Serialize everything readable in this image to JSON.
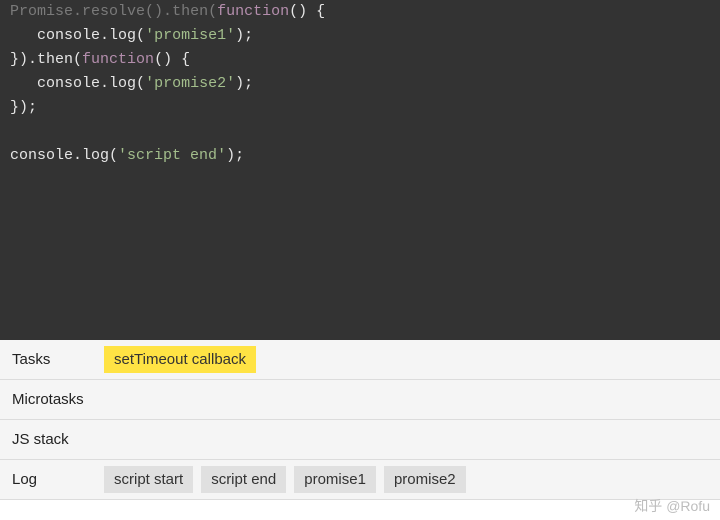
{
  "code": {
    "line1_a": "Promise",
    "line1_b": ".",
    "line1_c": "resolve",
    "line1_d": "().",
    "line1_e": "then",
    "line1_f": "(",
    "line1_g": "function",
    "line1_h": "() {",
    "line2_a": "   console.",
    "line2_b": "log",
    "line2_c": "(",
    "line2_d": "'promise1'",
    "line2_e": ");",
    "line3_a": "}).",
    "line3_b": "then",
    "line3_c": "(",
    "line3_d": "function",
    "line3_e": "() {",
    "line4_a": "   console.",
    "line4_b": "log",
    "line4_c": "(",
    "line4_d": "'promise2'",
    "line4_e": ");",
    "line5": "});",
    "line7_a": "console.",
    "line7_b": "log",
    "line7_c": "(",
    "line7_d": "'script end'",
    "line7_e": ");"
  },
  "rows": {
    "tasks": {
      "label": "Tasks",
      "items": [
        "setTimeout callback"
      ],
      "activeIndex": 0
    },
    "microtasks": {
      "label": "Microtasks",
      "items": []
    },
    "jsstack": {
      "label": "JS stack",
      "items": []
    },
    "log": {
      "label": "Log",
      "items": [
        "script start",
        "script end",
        "promise1",
        "promise2"
      ],
      "activeIndex": -1
    }
  },
  "watermark": "知乎 @Rofu",
  "watermark2": ""
}
